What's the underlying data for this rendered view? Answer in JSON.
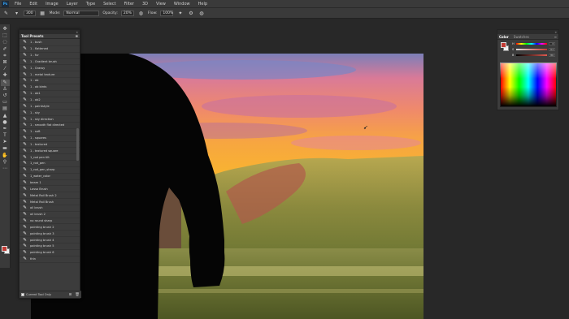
{
  "menubar": {
    "logo": "Ps",
    "items": [
      "File",
      "Edit",
      "Image",
      "Layer",
      "Type",
      "Select",
      "Filter",
      "3D",
      "View",
      "Window",
      "Help"
    ]
  },
  "options": {
    "brush_size": "300",
    "mode_label": "Mode:",
    "mode_value": "Normal",
    "opacity_label": "Opacity:",
    "opacity_value": "20%",
    "flow_label": "Flow:",
    "flow_value": "100%"
  },
  "presets_panel": {
    "title": "Tool Presets",
    "items": [
      "1 - bush",
      "1 - flattened",
      "1 - fur",
      "1 - Gradient brush",
      "1 - Grassy",
      "1 - metal texture",
      "1 - ob",
      "1 - ob birds",
      "1 - ob1",
      "1 - ob2",
      "1 - paintstyle",
      "1 - sky",
      "1 - sky direction",
      "1 - smooth flat directed",
      "1 - soft",
      "1 - squares",
      "1 - textured",
      "1 - textured square",
      "1_rod pen tilt",
      "1_rod_pen",
      "1_rod_pen_sharp",
      "1_water_color",
      "beam 1",
      "Lasso Brush",
      "Metal Rail Brush 2",
      "Metal Rail Brush",
      "oil brush",
      "oil brush 2",
      "no round sharp",
      "painting brush 2",
      "painting brush 3",
      "painting brush 4",
      "painting brush 5",
      "painting brush 6",
      "thin"
    ],
    "footer_label": "Current Tool Only"
  },
  "color_panel": {
    "tabs": [
      "Color",
      "Swatches"
    ],
    "sliders": [
      {
        "label": "H",
        "value": "3"
      },
      {
        "label": "S",
        "value": "64"
      },
      {
        "label": "B",
        "value": "86"
      }
    ],
    "foreground_color": "#c23b34",
    "background_color": "#f2f2f2"
  },
  "colors": {
    "panel_bg": "#3c3c3c",
    "app_bg": "#282828",
    "accent": "#31a8ff"
  }
}
